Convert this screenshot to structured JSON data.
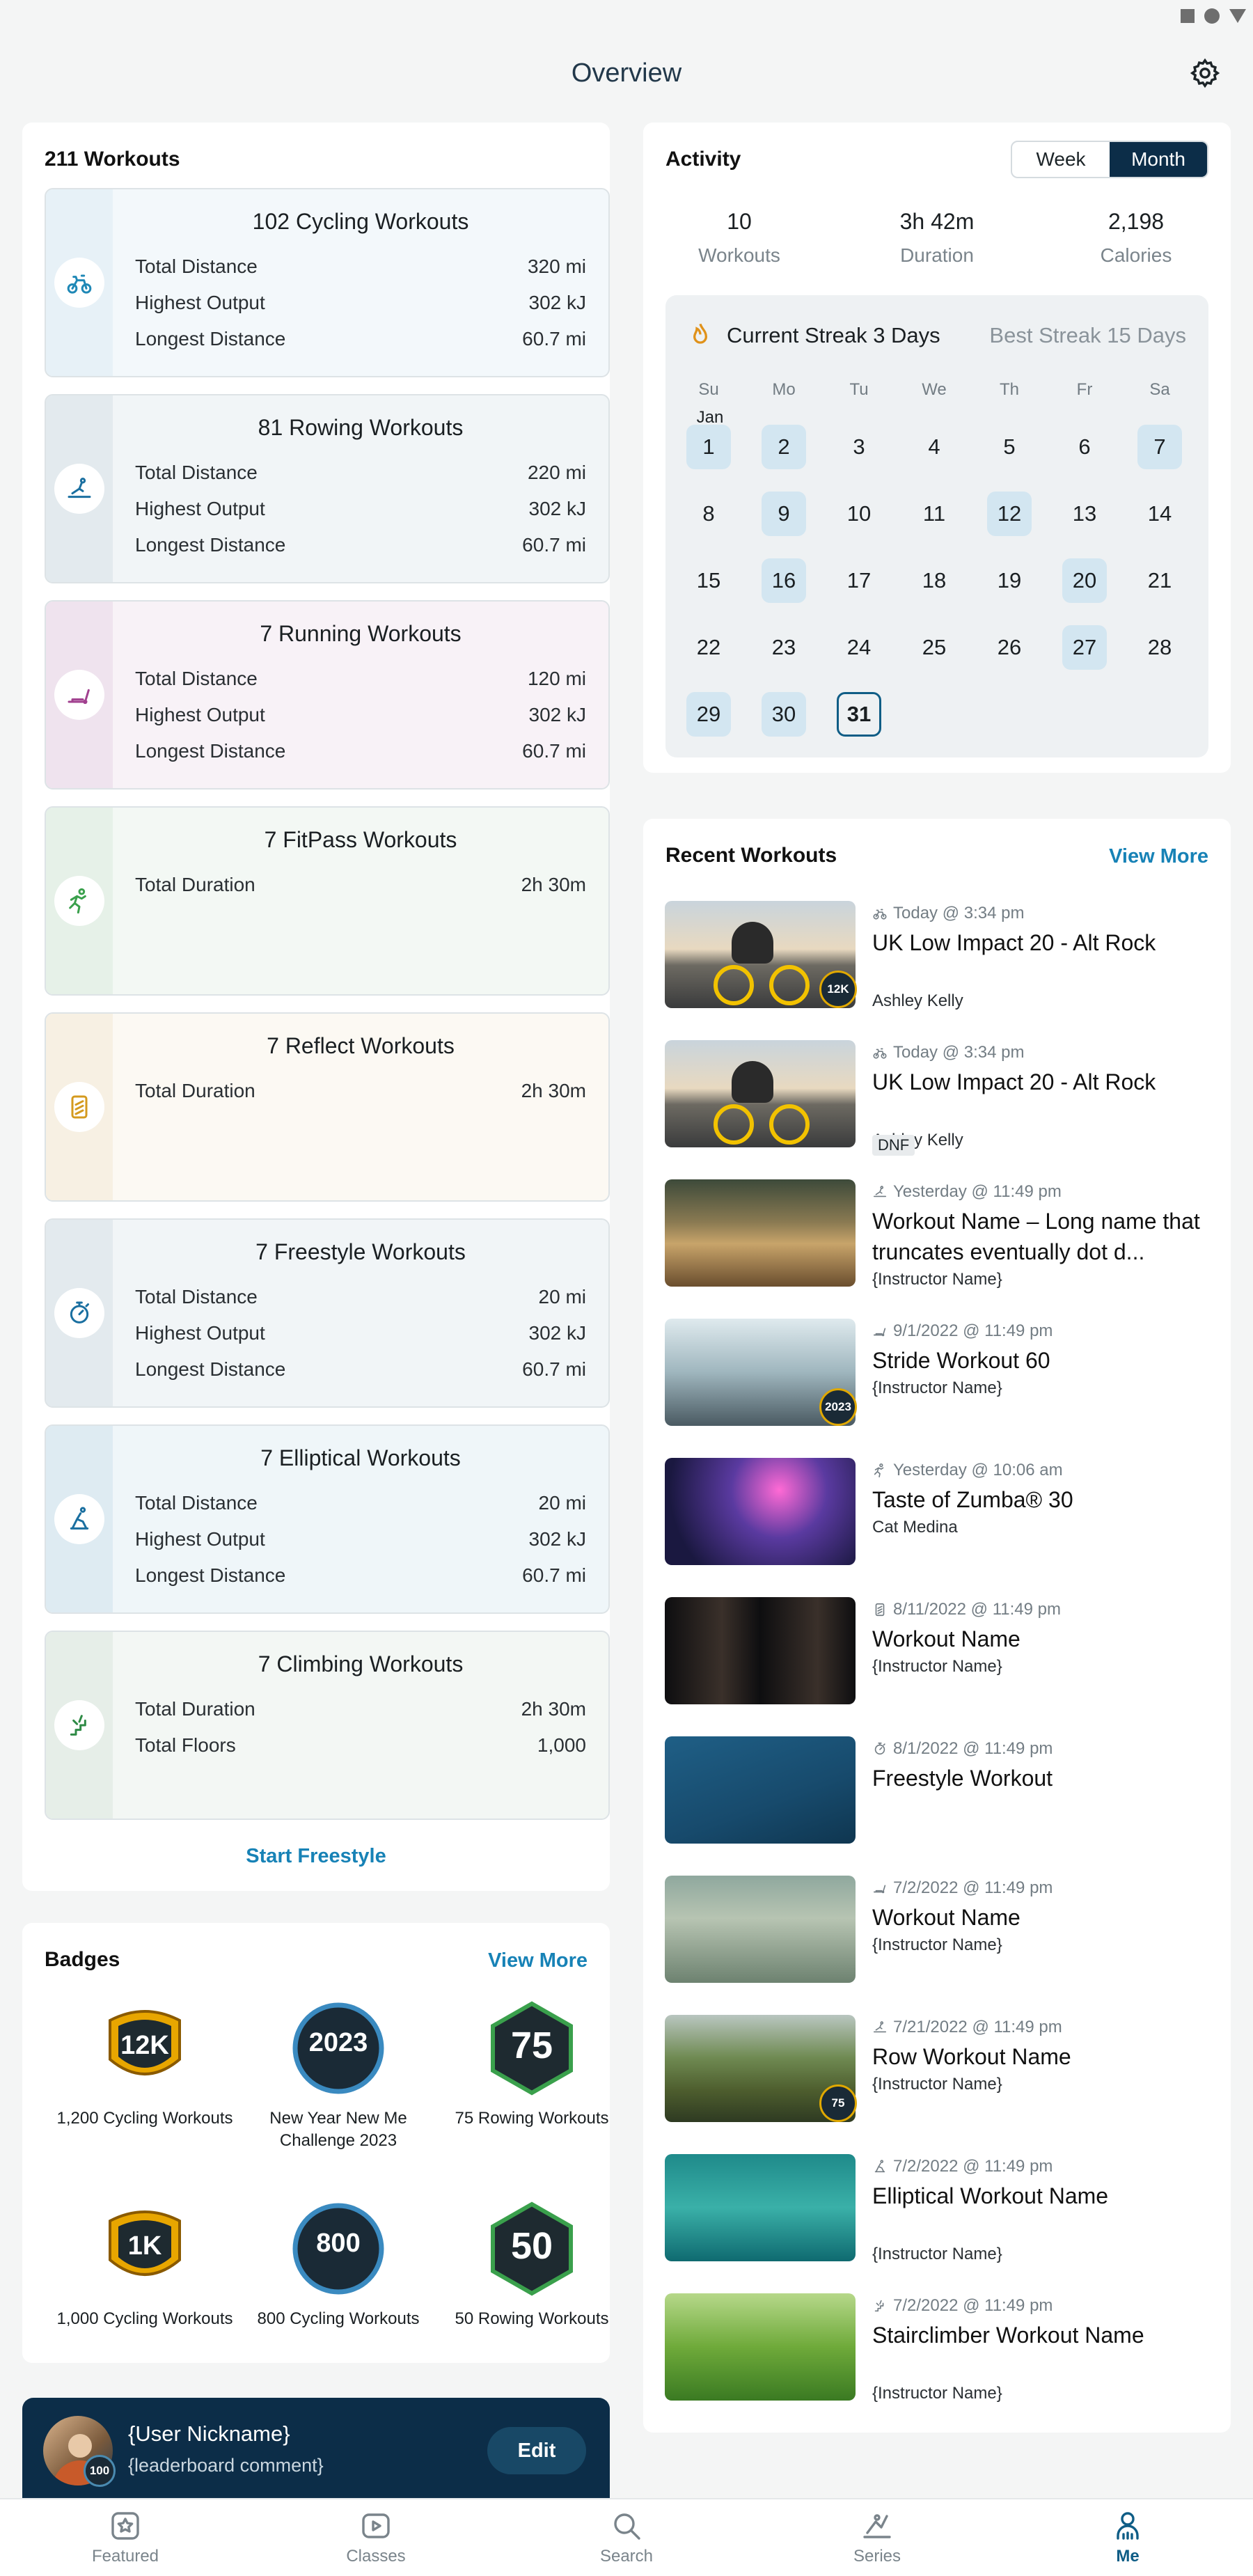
{
  "header": {
    "title": "Overview"
  },
  "workouts": {
    "total": "211 Workouts",
    "cards": [
      {
        "title": "102 Cycling Workouts",
        "icon": "bike-icon",
        "bg": "#f3f8fb",
        "strip": "#e7f1f7",
        "color": "#1f88b6",
        "rows": [
          {
            "label": "Total Distance",
            "value": "320 mi"
          },
          {
            "label": "Highest Output",
            "value": "302 kJ"
          },
          {
            "label": "Longest Distance",
            "value": "60.7 mi"
          }
        ]
      },
      {
        "title": "81 Rowing Workouts",
        "icon": "rower-icon",
        "bg": "#f1f5f7",
        "strip": "#e3eaee",
        "color": "#1a6fa0",
        "rows": [
          {
            "label": "Total Distance",
            "value": "220 mi"
          },
          {
            "label": "Highest Output",
            "value": "302 kJ"
          },
          {
            "label": "Longest Distance",
            "value": "60.7 mi"
          }
        ]
      },
      {
        "title": "7 Running Workouts",
        "icon": "treadmill-icon",
        "bg": "#f8f2f7",
        "strip": "#efe3ee",
        "color": "#a1408f",
        "rows": [
          {
            "label": "Total Distance",
            "value": "120 mi"
          },
          {
            "label": "Highest Output",
            "value": "302 kJ"
          },
          {
            "label": "Longest Distance",
            "value": "60.7 mi"
          }
        ]
      },
      {
        "title": "7 FitPass Workouts",
        "icon": "fitpass-icon",
        "bg": "#f3f8f4",
        "strip": "#e6f1e8",
        "color": "#3aa04c",
        "rows": [
          {
            "label": "Total Duration",
            "value": "2h 30m"
          }
        ]
      },
      {
        "title": "7 Reflect Workouts",
        "icon": "reflect-icon",
        "bg": "#fcf9f3",
        "strip": "#f7f0e3",
        "color": "#d49a1e",
        "rows": [
          {
            "label": "Total Duration",
            "value": "2h 30m"
          }
        ]
      },
      {
        "title": "7 Freestyle Workouts",
        "icon": "stopwatch-icon",
        "bg": "#f1f5f7",
        "strip": "#e3eaee",
        "color": "#1a6fa0",
        "rows": [
          {
            "label": "Total Distance",
            "value": "20 mi"
          },
          {
            "label": "Highest Output",
            "value": "302 kJ"
          },
          {
            "label": "Longest Distance",
            "value": "60.7 mi"
          }
        ]
      },
      {
        "title": "7 Elliptical Workouts",
        "icon": "elliptical-icon",
        "bg": "#eff6f9",
        "strip": "#deebf2",
        "color": "#1a6fa0",
        "rows": [
          {
            "label": "Total Distance",
            "value": "20 mi"
          },
          {
            "label": "Highest Output",
            "value": "302 kJ"
          },
          {
            "label": "Longest Distance",
            "value": "60.7 mi"
          }
        ]
      },
      {
        "title": "7 Climbing Workouts",
        "icon": "climber-icon",
        "bg": "#f3f7f4",
        "strip": "#e6eee8",
        "color": "#2e8a45",
        "rows": [
          {
            "label": "Total Duration",
            "value": "2h 30m"
          },
          {
            "label": "Total Floors",
            "value": "1,000"
          }
        ]
      }
    ],
    "start_freestyle": "Start Freestyle"
  },
  "activity": {
    "title": "Activity",
    "toggle": [
      "Week",
      "Month"
    ],
    "stats": [
      {
        "value": "10",
        "label": "Workouts"
      },
      {
        "value": "3h 42m",
        "label": "Duration"
      },
      {
        "value": "2,198",
        "label": "Calories"
      }
    ],
    "current_streak": "Current Streak 3 Days",
    "best_streak": "Best Streak 15 Days",
    "weekdays": [
      "Su",
      "Mo",
      "Tu",
      "We",
      "Th",
      "Fr",
      "Sa"
    ],
    "month_label": "Jan",
    "days": [
      "1",
      "2",
      "3",
      "4",
      "5",
      "6",
      "7",
      "8",
      "9",
      "10",
      "11",
      "12",
      "13",
      "14",
      "15",
      "16",
      "17",
      "18",
      "19",
      "20",
      "21",
      "22",
      "23",
      "24",
      "25",
      "26",
      "27",
      "28",
      "29",
      "30",
      "31"
    ],
    "highlighted": [
      1,
      2,
      7,
      9,
      12,
      16,
      20,
      27,
      29,
      30
    ],
    "today": 31
  },
  "recent": {
    "title": "Recent Workouts",
    "view_more": "View More",
    "items": [
      {
        "meta": "Today @ 3:34 pm",
        "title": "UK Low Impact 20 - Alt Rock",
        "instructor": "Ashley Kelly",
        "icon": "bike-icon",
        "thumb": "cyclist",
        "badge": "12K"
      },
      {
        "meta": "Today @ 3:34 pm",
        "title": "UK Low Impact 20 - Alt Rock",
        "instructor": "Ashley Kelly",
        "icon": "bike-icon",
        "thumb": "cyclist",
        "dnf": "DNF"
      },
      {
        "meta": "Yesterday @ 11:49 pm",
        "title": "Workout Name – Long name that truncates eventually dot d...",
        "instructor": "{Instructor Name}",
        "icon": "rower-icon",
        "thumb": "paddle"
      },
      {
        "meta": "9/1/2022 @ 11:49 pm",
        "title": "Stride Workout 60",
        "instructor": "{Instructor Name}",
        "icon": "treadmill-icon",
        "thumb": "gym",
        "badge": "2023"
      },
      {
        "meta": "Yesterday @ 10:06 am",
        "title": "Taste of Zumba® 30",
        "instructor": "Cat Medina",
        "icon": "fitpass-icon",
        "thumb": "zumba"
      },
      {
        "meta": "8/11/2022 @ 11:49 pm",
        "title": "Workout Name",
        "instructor": "{Instructor Name}",
        "icon": "reflect-icon",
        "thumb": "mirror"
      },
      {
        "meta": "8/1/2022 @ 11:49 pm",
        "title": "Freestyle Workout",
        "instructor": "",
        "icon": "stopwatch-icon",
        "thumb": "blueprint"
      },
      {
        "meta": "7/2/2022 @ 11:49 pm",
        "title": "Workout Name",
        "instructor": "{Instructor Name}",
        "icon": "treadmill-icon",
        "thumb": "flowers"
      },
      {
        "meta": "7/21/2022 @ 11:49 pm",
        "title": "Row Workout Name",
        "instructor": "{Instructor Name}",
        "icon": "rower-icon",
        "thumb": "river",
        "badge": "75"
      },
      {
        "meta": "7/2/2022 @ 11:49 pm",
        "title": "Elliptical Workout Name",
        "instructor": "{Instructor Name}",
        "icon": "elliptical-icon",
        "thumb": "ocean"
      },
      {
        "meta": "7/2/2022 @ 11:49 pm",
        "title": "Stairclimber Workout Name",
        "instructor": "{Instructor Name}",
        "icon": "climber-icon",
        "thumb": "grass"
      }
    ]
  },
  "badges": {
    "title": "Badges",
    "view_more": "View More",
    "items": [
      {
        "text": "12K",
        "label": "1,200 Cycling Workouts",
        "shape": "shield"
      },
      {
        "text": "2023",
        "label": "New Year New Me Challenge 2023",
        "shape": "circle"
      },
      {
        "text": "75",
        "label": "75 Rowing Workouts",
        "shape": "hex"
      },
      {
        "text": "1K",
        "label": "1,000 Cycling Workouts",
        "shape": "shield"
      },
      {
        "text": "800",
        "label": "800 Cycling Workouts",
        "shape": "circle"
      },
      {
        "text": "50",
        "label": "50 Rowing Workouts",
        "shape": "hex"
      }
    ]
  },
  "profile": {
    "nickname": "{User Nickname}",
    "comment": "{leaderboard comment}",
    "edit": "Edit",
    "avatar_badge": "100"
  },
  "nav": [
    {
      "label": "Featured",
      "icon": "star-icon"
    },
    {
      "label": "Classes",
      "icon": "play-icon"
    },
    {
      "label": "Search",
      "icon": "search-icon"
    },
    {
      "label": "Series",
      "icon": "series-icon"
    },
    {
      "label": "Me",
      "icon": "person-icon",
      "active": true
    }
  ]
}
